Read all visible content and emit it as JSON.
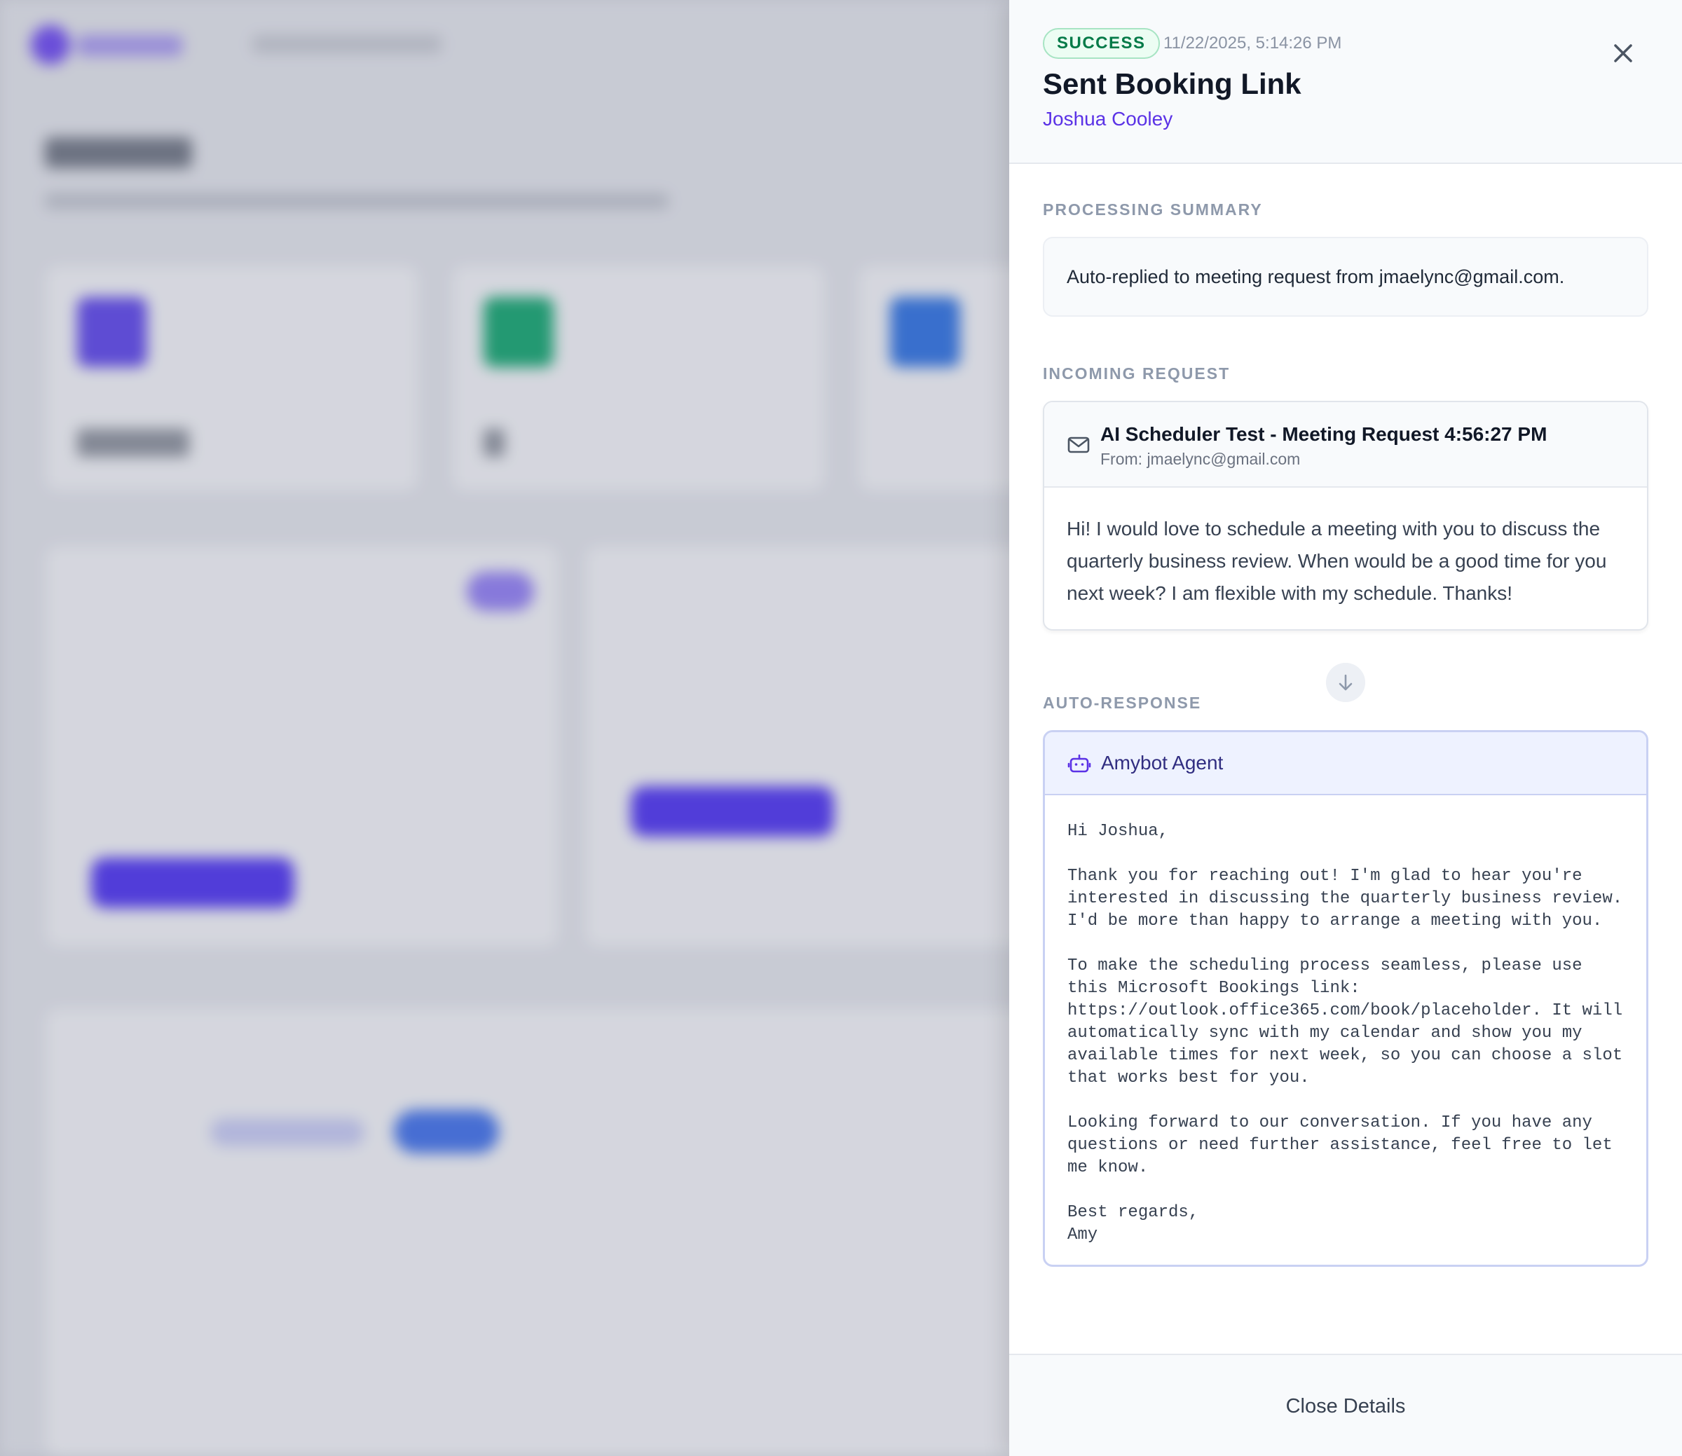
{
  "drawer": {
    "status": "SUCCESS",
    "timestamp": "11/22/2025, 5:14:26 PM",
    "title": "Sent Booking Link",
    "contact": "Joshua Cooley",
    "icons": {
      "close": "close-x-icon",
      "mail": "mail-icon",
      "agent": "bot-icon",
      "flow": "arrow-down-icon"
    }
  },
  "summary": {
    "label": "PROCESSING SUMMARY",
    "text": "Auto-replied to meeting request from jmaelync@gmail.com."
  },
  "request": {
    "label": "INCOMING REQUEST",
    "subject": "AI Scheduler Test - Meeting Request 4:56:27 PM",
    "from": "From: jmaelync@gmail.com",
    "body": "Hi! I would love to schedule a meeting with you to discuss the quarterly business review. When would be a good time for you next week? I am flexible with my schedule. Thanks!"
  },
  "response": {
    "label": "AUTO-RESPONSE",
    "agent": "Amybot Agent",
    "body": "Hi Joshua,\n\nThank you for reaching out! I'm glad to hear you're\ninterested in discussing the quarterly business review.\nI'd be more than happy to arrange a meeting with you.\n\nTo make the scheduling process seamless, please use\nthis Microsoft Bookings link:\nhttps://outlook.office365.com/book/placeholder. It will\nautomatically sync with my calendar and show you my\navailable times for next week, so you can choose a slot\nthat works best for you.\n\nLooking forward to our conversation. If you have any\nquestions or need further assistance, feel free to let\nme know.\n\nBest regards,\nAmy"
  },
  "footer": {
    "close_label": "Close Details"
  },
  "colors": {
    "accent": "#5b32e6",
    "success": "#047a48",
    "background_blur": "#e2e4ea"
  }
}
